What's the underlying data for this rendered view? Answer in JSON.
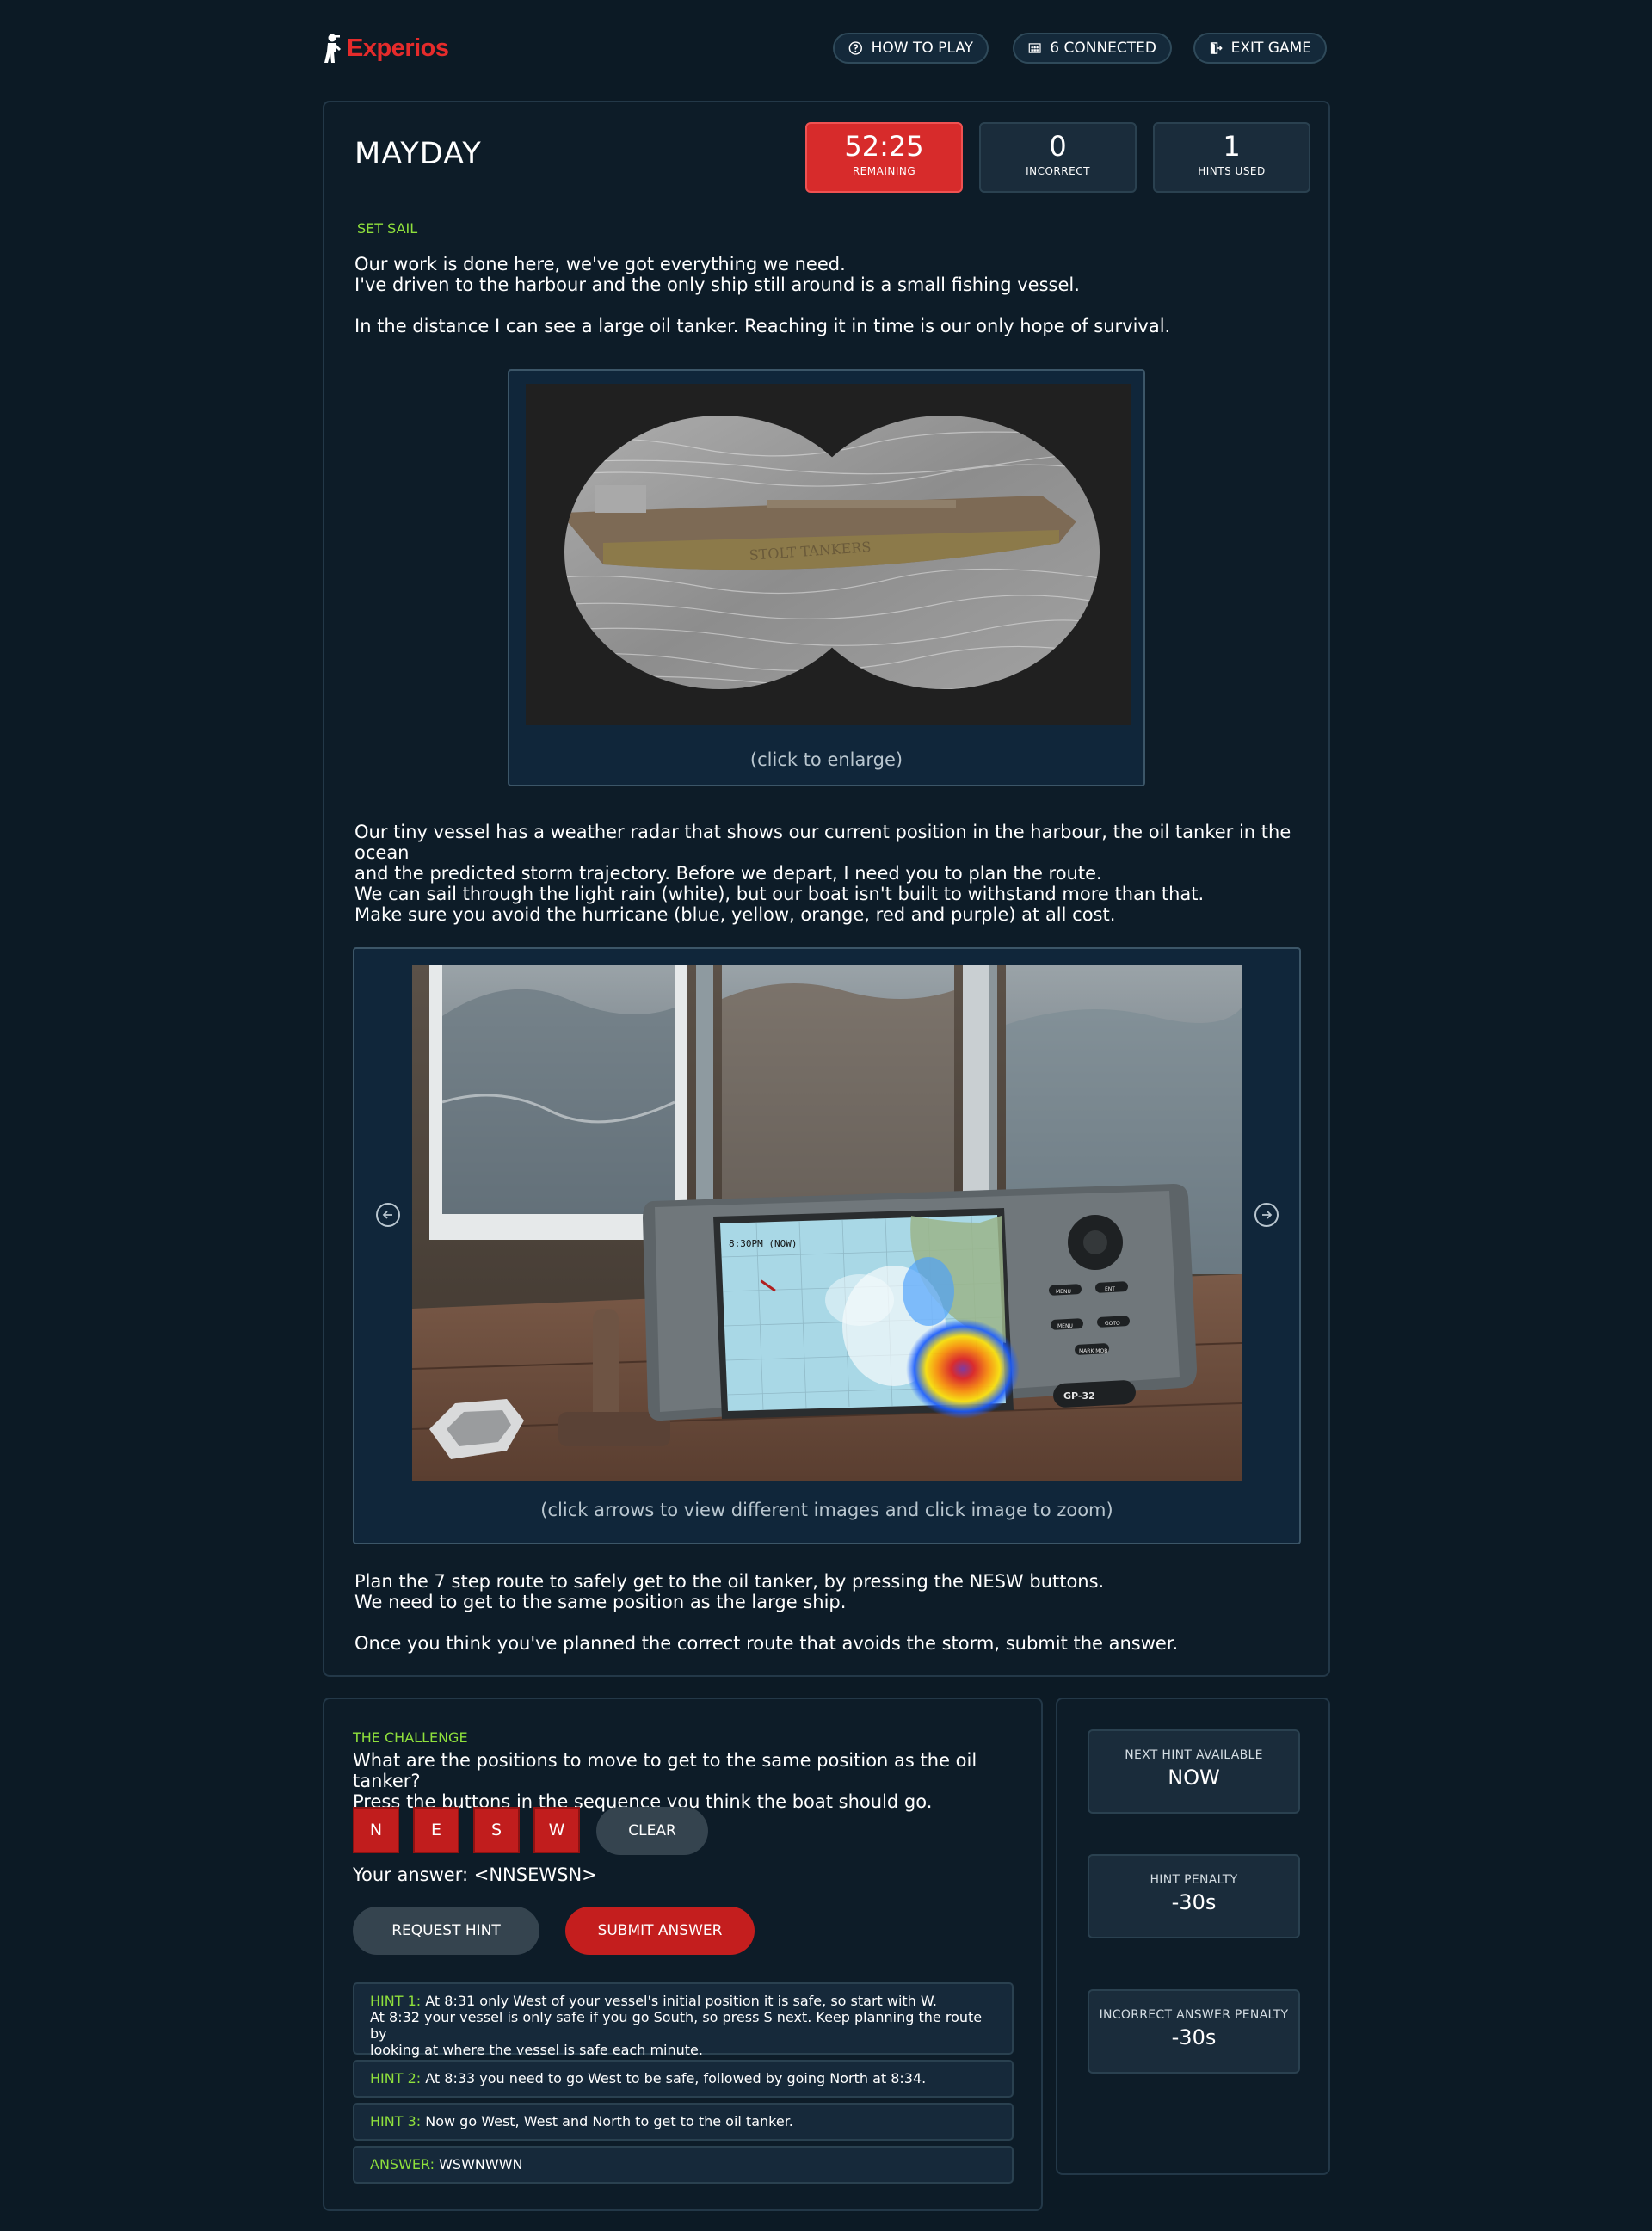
{
  "brand": {
    "name": "Experios"
  },
  "nav": {
    "how_to_play": "HOW TO PLAY",
    "connected": "6 CONNECTED",
    "exit_game": "EXIT GAME"
  },
  "game": {
    "title": "MAYDAY",
    "stats": {
      "remaining_value": "52:25",
      "remaining_label": "REMAINING",
      "incorrect_value": "0",
      "incorrect_label": "INCORRECT",
      "hints_value": "1",
      "hints_label": "HINTS USED"
    }
  },
  "story": {
    "section_label": "SET SAIL",
    "p1_line1": "Our work is done here, we've got everything we need.",
    "p1_line2": "I've driven to the harbour and the only ship still around is a small fishing vessel.",
    "p2": "In the distance I can see a large oil tanker. Reaching it in time is our only hope of survival.",
    "image1_text": "STOLT TANKERS",
    "image1_caption": "(click to enlarge)",
    "p3_line1": "Our tiny vessel has a weather radar that shows our current position in the harbour, the oil tanker in the ocean",
    "p3_line2": "and the predicted storm trajectory. Before we depart, I need you to plan the route.",
    "p4_line1": "We can sail through the light rain (white), but our boat isn't built to withstand more than that.",
    "p4_line2": "Make sure you avoid the hurricane (blue, yellow, orange, red and purple) at all cost.",
    "radar": {
      "time_text": "8:30PM (NOW)",
      "btn1": "MENU",
      "btn2": "ENT",
      "btn3": "MENU",
      "btn4": "GOTO",
      "btn5": "MARK MOB",
      "model": "GP-32"
    },
    "image2_caption": "(click arrows to view different images and click image to zoom)",
    "p5_line1": "Plan the 7 step route to safely get to the oil tanker, by pressing the NESW buttons.",
    "p5_line2": "We need to get to the same position as the large ship.",
    "p6": "Once you think you've planned the correct route that avoids the storm, submit the answer."
  },
  "challenge": {
    "label": "THE CHALLENGE",
    "question_line1": "What are the positions to move to get to the same position as the oil tanker?",
    "question_line2": "Press the buttons in the sequence you think the boat should go.",
    "buttons": [
      "N",
      "E",
      "S",
      "W"
    ],
    "clear": "CLEAR",
    "answer_prefix": "Your answer: ",
    "answer_value": "<NNSEWSN>",
    "request_hint": "REQUEST HINT",
    "submit_answer": "SUBMIT ANSWER",
    "hints": [
      {
        "label": "HINT 1:",
        "text": "At 8:31 only West of your vessel's initial position it is safe, so start with W.",
        "text2": "At 8:32 your vessel is only safe if you go South, so press S next. Keep planning the route by",
        "text3": "looking at where the vessel is safe each minute."
      },
      {
        "label": "HINT 2:",
        "text": "At 8:33 you need to go West to be safe, followed by going North at 8:34."
      },
      {
        "label": "HINT 3:",
        "text": "Now go West, West and North to get to the oil tanker."
      },
      {
        "label": "ANSWER:",
        "text": "WSWNWWN"
      }
    ]
  },
  "side": {
    "next_hint_label": "NEXT HINT AVAILABLE",
    "next_hint_value": "NOW",
    "hint_penalty_label": "HINT PENALTY",
    "hint_penalty_value": "-30s",
    "incorrect_penalty_label": "INCORRECT ANSWER PENALTY",
    "incorrect_penalty_value": "-30s"
  },
  "colors": {
    "accent_red": "#d72b2b",
    "accent_green": "#8fe03c",
    "background": "#0c1a25"
  }
}
